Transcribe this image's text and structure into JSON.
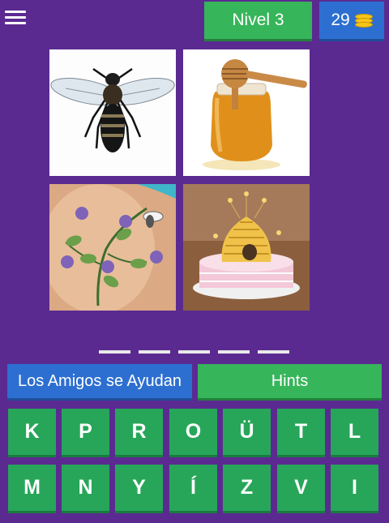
{
  "header": {
    "level_label": "Nivel 3",
    "coins": "29",
    "coin_icon": "coin-stack-icon",
    "menu_icon": "hamburger-menu-icon"
  },
  "images": [
    {
      "subject": "bee"
    },
    {
      "subject": "honey-jar"
    },
    {
      "subject": "bee-tattoo"
    },
    {
      "subject": "beehive-cake"
    }
  ],
  "answer": {
    "slots": [
      "",
      "",
      "",
      "",
      ""
    ]
  },
  "buttons": {
    "amigos_label": "Los Amigos se Ayudan",
    "hints_label": "Hints"
  },
  "keyboard": {
    "row1": [
      "K",
      "P",
      "R",
      "O",
      "Ü",
      "T",
      "L"
    ],
    "row2": [
      "M",
      "N",
      "Y",
      "Í",
      "Z",
      "V",
      "I"
    ]
  },
  "colors": {
    "background": "#5b2a91",
    "green": "#36b55a",
    "blue": "#2d6fd1",
    "key_green": "#27a65a"
  }
}
